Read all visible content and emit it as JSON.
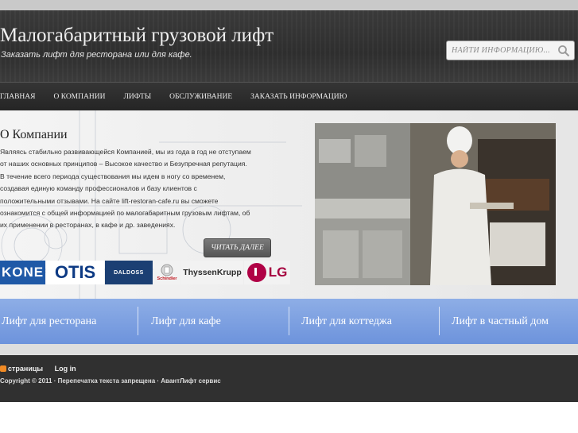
{
  "header": {
    "title": "Малогабаритный грузовой лифт",
    "tagline": "Заказать лифт для ресторана или для кафе.",
    "search_placeholder": "НАЙТИ ИНФОРМАЦИЮ..."
  },
  "nav": {
    "items": [
      "ГЛАВНАЯ",
      "О КОМПАНИИ",
      "ЛИФТЫ",
      "ОБСЛУЖИВАНИЕ",
      "ЗАКАЗАТЬ ИНФОРМАЦИЮ"
    ]
  },
  "about": {
    "title": "О Компании",
    "lines": [
      "Являясь стабильно развивающейся Компанией, мы из года в год не отступаем",
      "от наших основных принципов – Высокое качество и Безупречная репутация.",
      "В течение всего периода существования мы идем в ногу со временем,",
      "создавая единую команду профессионалов и базу клиентов с",
      "положительными отзывами. На сайте  lift-restoran-cafe.ru вы сможете",
      "ознакомится с общей информацией по малогабаритным грузовым лифтам, об",
      "их применении в ресторанах, в кафе и др. заведениях."
    ],
    "read_more": "ЧИТАТЬ ДАЛЕЕ"
  },
  "brands": {
    "kone": "KONE",
    "otis": "OTIS",
    "daldoss": "DALDOSS",
    "schindler": "Schindler",
    "thyssenkrupp": "ThyssenKrupp",
    "lg": "LG"
  },
  "categories": [
    "Лифт для ресторана",
    "Лифт для кафе",
    "Лифт для коттеджа",
    "Лифт в частный дом"
  ],
  "footer": {
    "pages_link": "страницы",
    "login_link": "Log in",
    "copyright": "Copyright © 2011 · Перепечатка текста запрещена · АвантЛифт сервис"
  },
  "colors": {
    "header_bg": "#333333",
    "category_bar": "#7b9fe0",
    "rss": "#f08a24"
  }
}
